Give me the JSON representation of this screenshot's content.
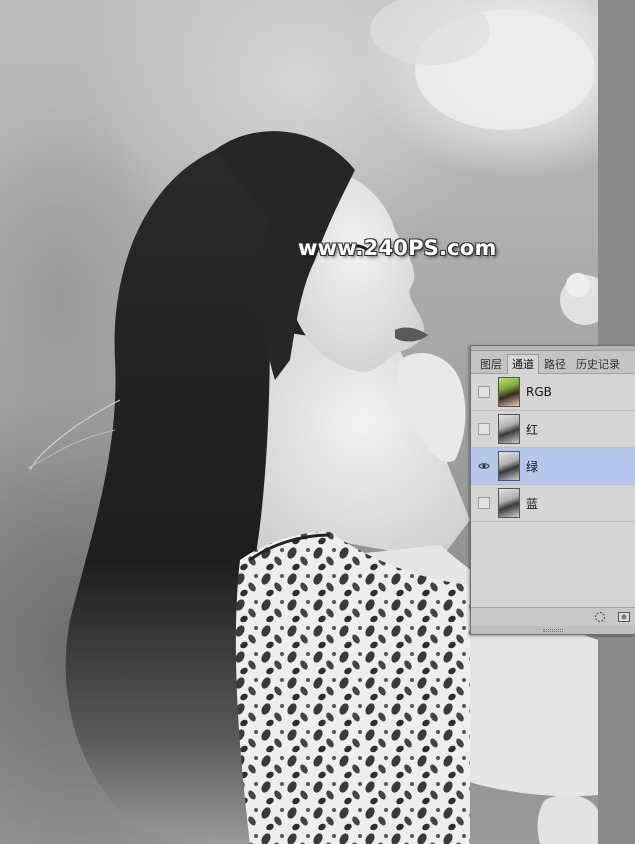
{
  "watermark": {
    "text": "www.240PS.com"
  },
  "channels_panel": {
    "tabs": [
      {
        "label": "图层",
        "active": false
      },
      {
        "label": "通道",
        "active": true
      },
      {
        "label": "路径",
        "active": false
      },
      {
        "label": "历史记录",
        "active": false
      }
    ],
    "channels": [
      {
        "label": "RGB",
        "visible": false,
        "selected": false
      },
      {
        "label": "红",
        "visible": false,
        "selected": false
      },
      {
        "label": "绿",
        "visible": true,
        "selected": true
      },
      {
        "label": "蓝",
        "visible": false,
        "selected": false
      }
    ],
    "footer_icons": [
      "load-selection-icon",
      "save-selection-icon"
    ]
  },
  "colors": {
    "selected_row": "#b5c8ec",
    "panel_bg": "#d5d5d5",
    "workspace": "#8a8a8a"
  }
}
